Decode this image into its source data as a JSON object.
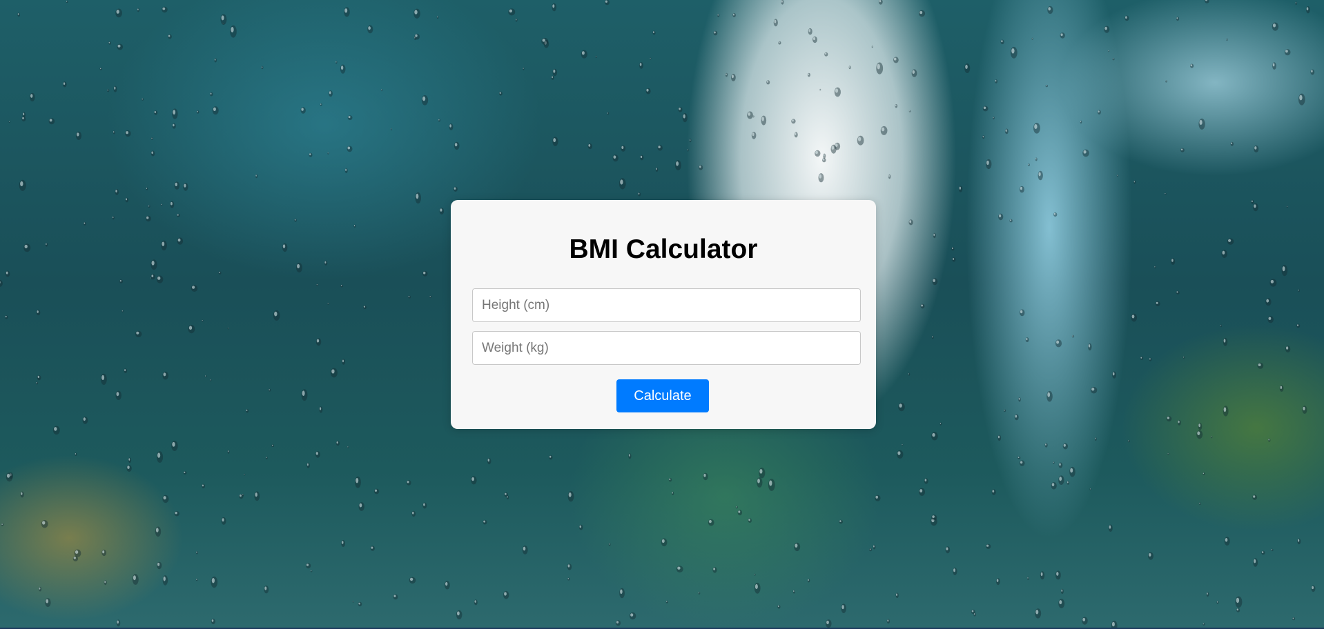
{
  "page": {
    "background": "rain-on-window-photo"
  },
  "calculator": {
    "title": "BMI Calculator",
    "height_placeholder": "Height (cm)",
    "height_value": "",
    "weight_placeholder": "Weight (kg)",
    "weight_value": "",
    "calculate_label": "Calculate"
  },
  "colors": {
    "accent": "#007bff",
    "card_background": "#f7f7f7"
  }
}
